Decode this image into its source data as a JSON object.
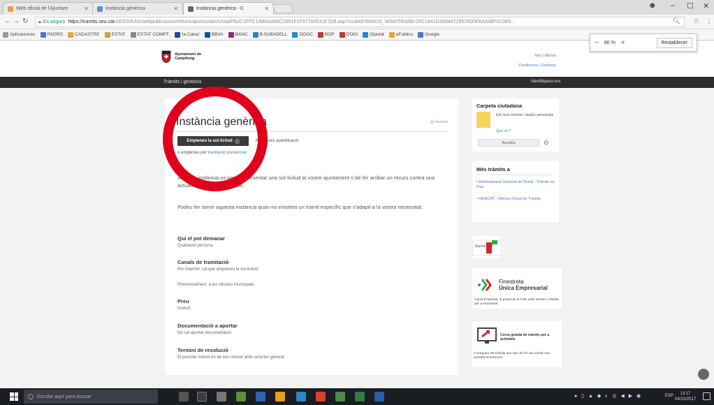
{
  "browser": {
    "tabs": [
      {
        "label": "Web oficial de l'Ajuntam",
        "fav": "#e39e3c"
      },
      {
        "label": "Instància genèrica",
        "fav": "#5a8bd6"
      },
      {
        "label": "Instància genèrica - C",
        "fav": "#666666"
      }
    ],
    "url": {
      "secure": "Es seguro",
      "host": "https://tramits.seu.cat",
      "path": "/AEGS/EAD/webpublicacion/eMunicipio/ocolais/Vista/Plis/C2FFC1AB8AA68C2851F1F97293531E7D8.asp?codeid=585816_W000TRAM0-00C1841D3A940228529D0FAA548F0C0E6..."
    },
    "bookmarks": [
      {
        "label": "Aplicaciones",
        "color": "#999999"
      },
      {
        "label": "PADRO",
        "color": "#4a78c5"
      },
      {
        "label": "CADASTRE",
        "color": "#e8a53b"
      },
      {
        "label": "ESTAT",
        "color": "#d1a23c"
      },
      {
        "label": "ESTAT COMPT.",
        "color": "#888888"
      },
      {
        "label": "'la Caixa'",
        "color": "#1b4f9c"
      },
      {
        "label": "BBVA",
        "color": "#1b4f9c"
      },
      {
        "label": "BANC",
        "color": "#9b2a6c"
      },
      {
        "label": "B.SABADELL",
        "color": "#2a86c5"
      },
      {
        "label": "DOGC",
        "color": "#2a86c5"
      },
      {
        "label": "BOP",
        "color": "#b03c3c"
      },
      {
        "label": "DOGI",
        "color": "#c03a3a"
      },
      {
        "label": "Diputat",
        "color": "#2a86c5"
      },
      {
        "label": "eFublics",
        "color": "#e8a53b"
      },
      {
        "label": "Google",
        "color": "#4a78c5"
      }
    ],
    "zoom": {
      "minus": "−",
      "value": "80 %",
      "plus": "+",
      "reset": "Restablecer"
    }
  },
  "site": {
    "logo_line1": "Ajuntament de",
    "logo_line2": "Campllong",
    "header_links": [
      "Inici | Idioma",
      "Condicions | Contacte"
    ],
    "nav_left": "Tràmits i gestions",
    "nav_right": "Identifiqueu-vos"
  },
  "main": {
    "title": "Instància genèrica",
    "print": "Imprimir",
    "start_button": "Empleneu la sol·licitud",
    "auth": "Requereix autenticació",
    "paper_prefix": "o empleneu per",
    "paper_link": "tramitació presencial",
    "para1": "Aquesta instància us permet presentar una sol·licitud al vostre ajuntament o bé fer arribar un recurs contra una actuació o decisió municipal.",
    "para2": "Podeu fer servir aquesta instància quan no existeixi un tràmit específic que s'adapti a la vostra necessitat.",
    "sections": [
      {
        "heading": "Qui el pot demanar",
        "lines": [
          "Qualsevol persona."
        ]
      },
      {
        "heading": "Canals de tramitació",
        "lines": [
          "Per Internet: cal que empleneu la sol·licitud.",
          "Presencialment: a les oficines municipals."
        ]
      },
      {
        "heading": "Preu",
        "lines": [
          "Gratuït."
        ]
      },
      {
        "heading": "Documentació a aportar",
        "lines": [
          "No cal aportar documentació."
        ]
      },
      {
        "heading": "Termini de resolució",
        "lines": [
          "El període màxim és de tres mesos amb caràcter general."
        ]
      }
    ]
  },
  "sidebar": {
    "carpeta": {
      "title": "Carpeta ciutadana",
      "desc": "Els teus tràmits i dades personals",
      "question": "Què és?",
      "access": "Accediu"
    },
    "mes": {
      "title": "Més tràmits a",
      "links": [
        "Administració General de l'Estat - Tràmits en línia",
        "GENCAT - Oficina Virtual de Tràmits"
      ]
    },
    "badge": "Ajuntament",
    "finestreta": {
      "line1": "Finestreta",
      "line2": "Única Empresarial",
      "desc": "Canal Empresa, el portal de la FUE amb serveis i tràmits per a empreses."
    },
    "cerca": {
      "title": "Cerca guiada de tràmits per a activitats",
      "desc": "Conegueu els tràmits que heu de fer per iniciar una activitat econòmica."
    }
  },
  "taskbar": {
    "search": "Escribe aquí para buscar",
    "lang": "ESP",
    "time": "13:17",
    "date": "04/10/2017"
  }
}
